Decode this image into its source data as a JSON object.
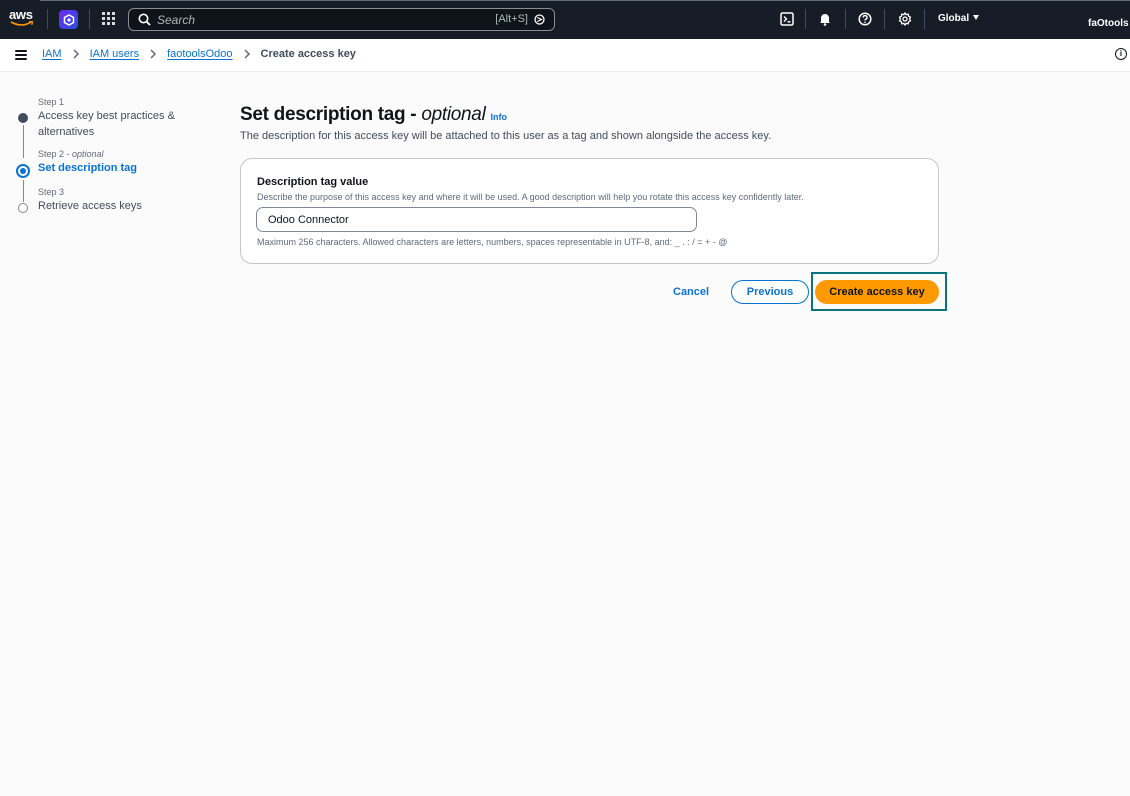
{
  "topnav": {
    "logo_text": "aws",
    "search": {
      "placeholder": "Search",
      "shortcut": "[Alt+S]"
    },
    "region": "Global",
    "account": "faOtools",
    "icons": [
      "cloudshell-icon",
      "bell-icon",
      "help-icon",
      "gear-icon"
    ]
  },
  "breadcrumb": {
    "items": [
      "IAM",
      "IAM users",
      "faotoolsOdoo"
    ],
    "current": "Create access key"
  },
  "steps": [
    {
      "number": "Step 1",
      "label": "Access key best practices & alternatives",
      "state": "completed"
    },
    {
      "number": "Step 2",
      "optional": "optional",
      "label": "Set description tag",
      "state": "active"
    },
    {
      "number": "Step 3",
      "label": "Retrieve access keys",
      "state": "pending"
    }
  ],
  "main": {
    "title": "Set description tag",
    "title_optional": "optional",
    "info_link": "Info",
    "subtitle": "The description for this access key will be attached to this user as a tag and shown alongside the access key.",
    "field": {
      "label": "Description tag value",
      "description": "Describe the purpose of this access key and where it will be used. A good description will help you rotate this access key confidently later.",
      "value": "Odoo Connector",
      "constraint": "Maximum 256 characters. Allowed characters are letters, numbers, spaces representable in UTF-8, and: _ . : / = + - @"
    },
    "buttons": {
      "cancel": "Cancel",
      "previous": "Previous",
      "create": "Create access key"
    }
  },
  "colors": {
    "nav_bg": "#161d26",
    "link_blue": "#0972d3",
    "primary_orange": "#ff9900",
    "focus_teal": "#0b7480"
  }
}
